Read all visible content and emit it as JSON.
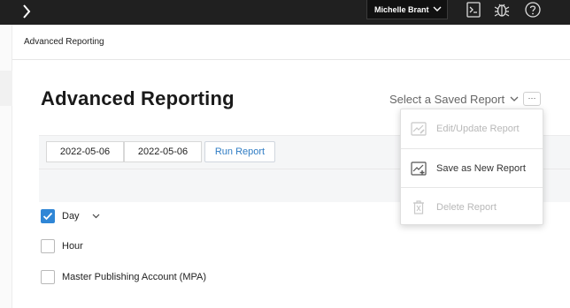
{
  "topbar": {
    "user_name": "Michelle Brant"
  },
  "breadcrumb": {
    "current": "Advanced Reporting"
  },
  "page": {
    "title": "Advanced Reporting",
    "saved_report_label": "Select a Saved Report",
    "more_label": "···"
  },
  "filters": {
    "start_date": "2022-05-06",
    "end_date": "2022-05-06",
    "run_label": "Run Report"
  },
  "dimensions": [
    {
      "label": "Day",
      "checked": true
    },
    {
      "label": "Hour",
      "checked": false
    },
    {
      "label": "Master Publishing Account (MPA)",
      "checked": false
    }
  ],
  "menu": {
    "items": [
      {
        "label": "Edit/Update Report",
        "icon": "edit-chart-icon",
        "enabled": false
      },
      {
        "label": "Save as New Report",
        "icon": "save-chart-icon",
        "enabled": true
      },
      {
        "label": "Delete Report",
        "icon": "trash-icon",
        "enabled": false
      }
    ]
  },
  "colors": {
    "topbar": "#202020",
    "accent": "#2f86d6",
    "link": "#2f7cc4",
    "disabled_text": "#b8b8b8"
  }
}
